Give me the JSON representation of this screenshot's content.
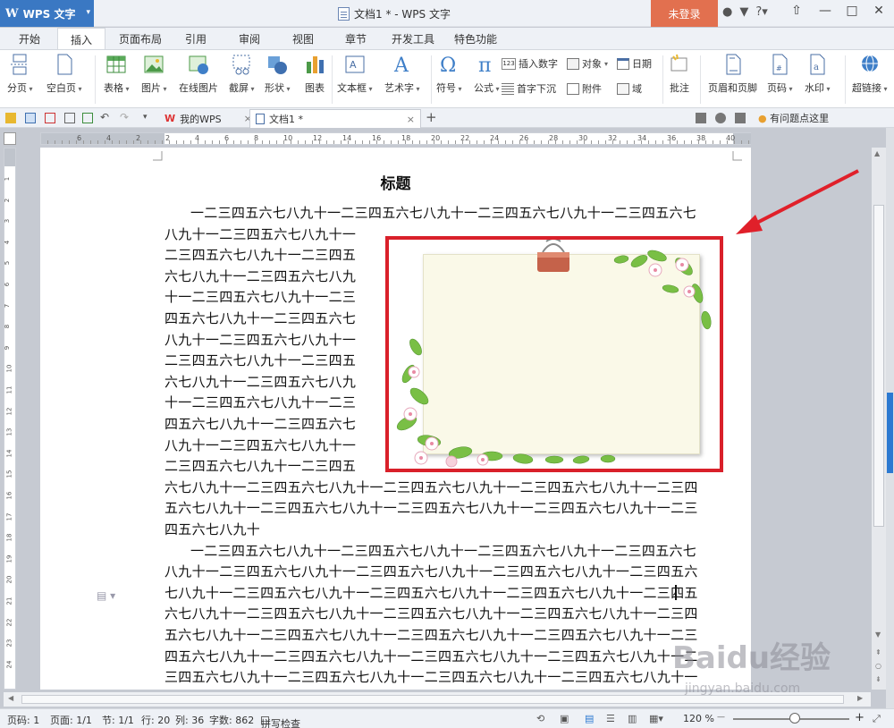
{
  "app": {
    "logo_text": "WPS 文字",
    "window_title": "文档1 * - WPS 文字",
    "login_label": "未登录",
    "help_label": "?"
  },
  "menu": {
    "tabs": [
      "开始",
      "插入",
      "页面布局",
      "引用",
      "审阅",
      "视图",
      "章节",
      "开发工具",
      "特色功能"
    ],
    "active_tab": "插入"
  },
  "ribbon": {
    "page_break": "分页",
    "blank_page": "空白页",
    "table": "表格",
    "picture": "图片",
    "online_picture": "在线图片",
    "screenshot": "截屏",
    "shapes": "形状",
    "chart": "图表",
    "textbox": "文本框",
    "wordart": "艺术字",
    "symbol": "符号",
    "formula": "公式",
    "insert_number": "插入数字",
    "object": "对象",
    "date": "日期",
    "drop_cap": "首字下沉",
    "attachment": "附件",
    "field": "域",
    "comment": "批注",
    "header_footer": "页眉和页脚",
    "page_number": "页码",
    "watermark": "水印",
    "hyperlink": "超链接",
    "num_badge": "123"
  },
  "doc_tabs": {
    "tab1": "我的WPS",
    "tab2": "文档1 *",
    "close": "×",
    "add": "+",
    "feedback": "有问题点这里"
  },
  "ruler": {
    "h_numbers": [
      "6",
      "4",
      "2",
      "2",
      "4",
      "6",
      "8",
      "10",
      "12",
      "14",
      "16",
      "18",
      "20",
      "22",
      "24",
      "26",
      "28",
      "30",
      "32",
      "34",
      "36",
      "38",
      "40"
    ],
    "v_numbers": [
      "1",
      "2",
      "3",
      "4",
      "5",
      "6",
      "7",
      "8",
      "9",
      "10",
      "11",
      "12",
      "13",
      "14",
      "15",
      "16",
      "17",
      "18",
      "19",
      "20",
      "21",
      "22",
      "23",
      "24"
    ]
  },
  "document": {
    "title": "标题",
    "lines_wrap": [
      "一二三四五六七八九十一二三四五六七八九十一二三四五六七八九十一二三四五六七",
      "八九十一二三四五六七八九十一",
      "二三四五六七八九十一二三四五",
      "六七八九十一二三四五六七八九",
      "十一二三四五六七八九十一二三",
      "四五六七八九十一二三四五六七",
      "八九十一二三四五六七八九十一",
      "二三四五六七八九十一二三四五",
      "六七八九十一二三四五六七八九",
      "十一二三四五六七八九十一二三",
      "四五六七八九十一二三四五六七",
      "八九十一二三四五六七八九十一",
      "二三四五六七八九十一二三四五",
      "六七八九十一二三四五六七八九十一二三四五六七八九十一二三四五六七八九十一二三四",
      "五六七八九十一二三四五六七八九十一二三四五六七八九十一二三四五六七八九十一二三",
      "四五六七八九十"
    ],
    "lines_para2": [
      "一二三四五六七八九十一二三四五六七八九十一二三四五六七八九十一二三四五六七",
      "八九十一二三四五六七八九十一二三四五六七八九十一二三四五六七八九十一二三四五六",
      "七八九十一二三四五六七八九十一二三四五六七八九十一二三四五六七八九十一二三四五",
      "六七八九十一二三四五六七八九十一二三四五六七八九十一二三四五六七八九十一二三四",
      "五六七八九十一二三四五六七八九十一二三四五六七八九十一二三四五六七八九十一二三",
      "四五六七八九十一二三四五六七八九十一二三四五六七八九十一二三四五六七八九十一二",
      "三四五六七八九十一二三四五六七八九十一二三四五六七八九十一二三四五六七八九十一"
    ]
  },
  "status": {
    "page_code": "页码: 1",
    "pages": "页面: 1/1",
    "section": "节: 1/1",
    "row": "行: 20",
    "col": "列: 36",
    "word_count": "字数: 862",
    "spell_check": "拼写检查",
    "zoom": "120 %",
    "zoom_out": "—",
    "zoom_in": "+"
  },
  "watermark": {
    "logo": "Baidu经验",
    "url": "jingyan.baidu.com"
  },
  "colors": {
    "accent": "#3a78c3",
    "login": "#e2704f",
    "highlight_box": "#d9202a",
    "arrow": "#e0202a"
  }
}
